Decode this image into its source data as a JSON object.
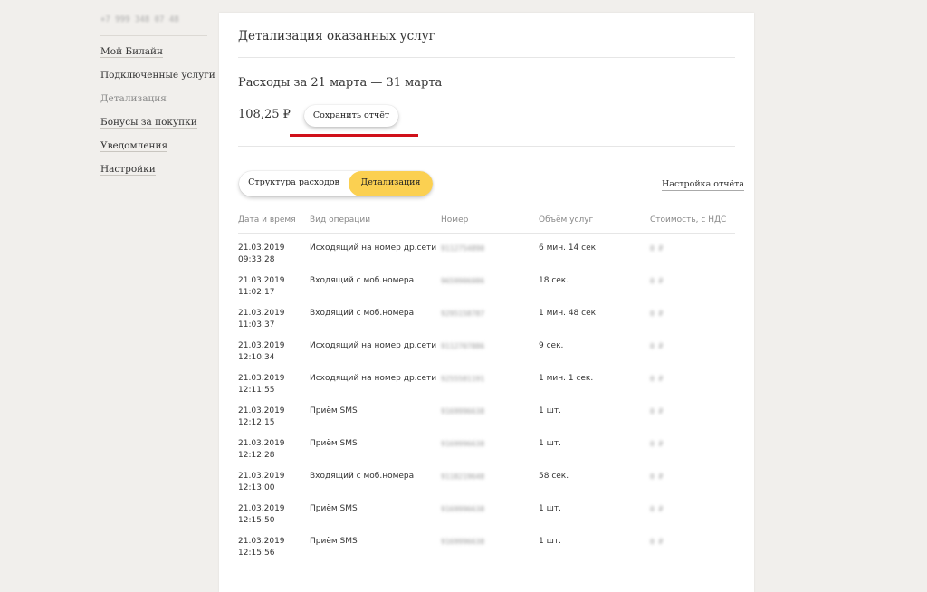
{
  "sidebar": {
    "phone": "+7 999 348 07 48",
    "items": [
      {
        "label": "Мой Билайн"
      },
      {
        "label": "Подключенные услуги"
      },
      {
        "label": "Детализация"
      },
      {
        "label": "Бонусы за покупки"
      },
      {
        "label": "Уведомления"
      },
      {
        "label": "Настройки"
      }
    ]
  },
  "panel": {
    "title": "Детализация оказанных услуг",
    "period": "Расходы за 21 марта — 31 марта",
    "total": "108,25 ₽",
    "save_label": "Сохранить отчёт",
    "tabs": [
      {
        "label": "Структура расходов"
      },
      {
        "label": "Детализация"
      }
    ],
    "report_settings": "Настройка отчёта"
  },
  "table": {
    "headers": [
      "Дата и время",
      "Вид операции",
      "Номер",
      "Объём услуг",
      "Стоимость, с НДС"
    ],
    "rows": [
      {
        "date": "21.03.2019",
        "time": "09:33:28",
        "op": "Исходящий на номер др.сети",
        "number": "9112754890",
        "volume": "6 мин. 14 сек.",
        "cost": "0 ₽"
      },
      {
        "date": "21.03.2019",
        "time": "11:02:17",
        "op": "Входящий с моб.номера",
        "number": "9659906086",
        "volume": "18 сек.",
        "cost": "0 ₽"
      },
      {
        "date": "21.03.2019",
        "time": "11:03:37",
        "op": "Входящий с моб.номера",
        "number": "9295158787",
        "volume": "1 мин. 48 сек.",
        "cost": "0 ₽"
      },
      {
        "date": "21.03.2019",
        "time": "12:10:34",
        "op": "Исходящий на номер др.сети",
        "number": "9112707886",
        "volume": "9 сек.",
        "cost": "0 ₽"
      },
      {
        "date": "21.03.2019",
        "time": "12:11:55",
        "op": "Исходящий на номер др.сети",
        "number": "9255581191",
        "volume": "1 мин. 1 сек.",
        "cost": "0 ₽"
      },
      {
        "date": "21.03.2019",
        "time": "12:12:15",
        "op": "Приём SMS",
        "number": "9169996638",
        "volume": "1 шт.",
        "cost": "0 ₽"
      },
      {
        "date": "21.03.2019",
        "time": "12:12:28",
        "op": "Приём SMS",
        "number": "9169996638",
        "volume": "1 шт.",
        "cost": "0 ₽"
      },
      {
        "date": "21.03.2019",
        "time": "12:13:00",
        "op": "Входящий с моб.номера",
        "number": "9118219648",
        "volume": "58 сек.",
        "cost": "0 ₽"
      },
      {
        "date": "21.03.2019",
        "time": "12:15:50",
        "op": "Приём SMS",
        "number": "9169996638",
        "volume": "1 шт.",
        "cost": "0 ₽"
      },
      {
        "date": "21.03.2019",
        "time": "12:15:56",
        "op": "Приём SMS",
        "number": "9169996638",
        "volume": "1 шт.",
        "cost": "0 ₽"
      }
    ]
  },
  "colors": {
    "accent": "#fbd051",
    "highlight": "#d0101a"
  }
}
